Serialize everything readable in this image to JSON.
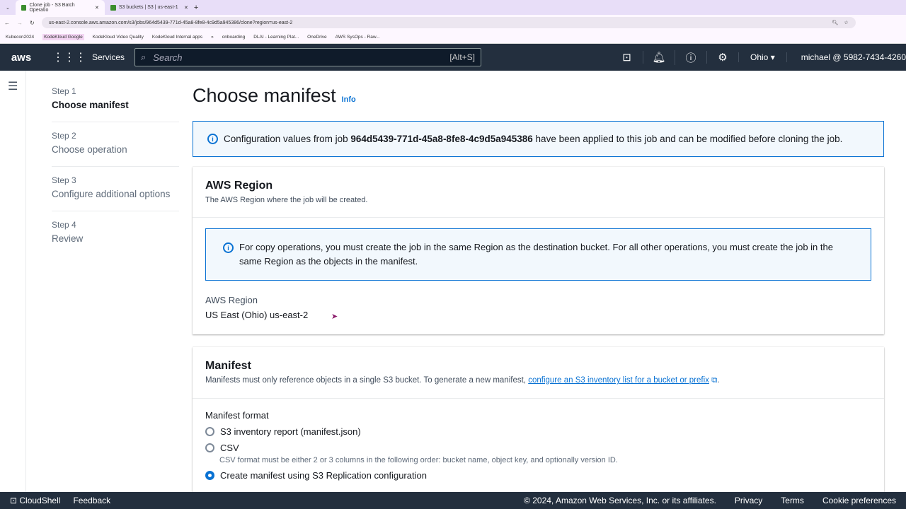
{
  "browser": {
    "tabs": [
      {
        "title": "Clone job - S3 Batch Operatio",
        "active": true
      },
      {
        "title": "S3 buckets | S3 | us-east-1",
        "active": false
      }
    ],
    "url": "us-east-2.console.aws.amazon.com/s3/jobs/964d5439-771d-45a8-8fe8-4c9d5a945386/clone?region=us-east-2",
    "bookmarks": [
      "Kubecon2024",
      "KodeKloud Google",
      "KodeKloud Video Quality",
      "KodeKloud Internal apps",
      "»",
      "onboarding",
      "DLAI - Learning Plat...",
      "OneDrive",
      "AWS SysOps - Raw..."
    ]
  },
  "nav": {
    "logo": "aws",
    "services": "Services",
    "search_placeholder": "Search",
    "search_shortcut": "[Alt+S]",
    "region": "Ohio",
    "user": "michael @ 5982-7434-4260"
  },
  "steps": [
    {
      "step": "Step 1",
      "label": "Choose manifest",
      "current": true
    },
    {
      "step": "Step 2",
      "label": "Choose operation"
    },
    {
      "step": "Step 3",
      "label": "Configure additional options"
    },
    {
      "step": "Step 4",
      "label": "Review"
    }
  ],
  "page": {
    "title": "Choose manifest",
    "info": "Info",
    "flash": {
      "pre": "Configuration values from job ",
      "job_id": "964d5439-771d-45a8-8fe8-4c9d5a945386",
      "post": " have been applied to this job and can be modified before cloning the job."
    }
  },
  "region_card": {
    "title": "AWS Region",
    "description": "The AWS Region where the job will be created.",
    "alert": "For copy operations, you must create the job in the same Region as the destination bucket. For all other operations, you must create the job in the same Region as the objects in the manifest.",
    "label": "AWS Region",
    "value": "US East (Ohio) us-east-2"
  },
  "manifest_card": {
    "title": "Manifest",
    "description": "Manifests must only reference objects in a single S3 bucket. To generate a new manifest, ",
    "link": "configure an S3 inventory list for a bucket or prefix",
    "after": ".",
    "format_label": "Manifest format",
    "options": [
      {
        "label": "S3 inventory report (manifest.json)",
        "selected": false
      },
      {
        "label": "CSV",
        "selected": false,
        "desc": "CSV format must be either 2 or 3 columns in the following order: bucket name, object key, and optionally version ID."
      },
      {
        "label": "Create manifest using S3 Replication configuration",
        "selected": true
      }
    ]
  },
  "footer": {
    "cloudshell": "CloudShell",
    "feedback": "Feedback",
    "copyright": "© 2024, Amazon Web Services, Inc. or its affiliates.",
    "privacy": "Privacy",
    "terms": "Terms",
    "cookies": "Cookie preferences"
  }
}
